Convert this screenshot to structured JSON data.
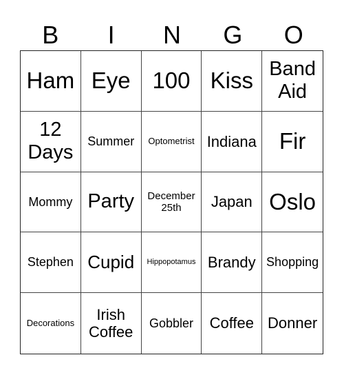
{
  "header": [
    "B",
    "I",
    "N",
    "G",
    "O"
  ],
  "cells": [
    [
      "Ham",
      "Eye",
      "100",
      "Kiss",
      "Band Aid"
    ],
    [
      "12 Days",
      "Summer",
      "Optometrist",
      "Indiana",
      "Fir"
    ],
    [
      "Mommy",
      "Party",
      "December 25th",
      "Japan",
      "Oslo"
    ],
    [
      "Stephen",
      "Cupid",
      "Hippopotamus",
      "Brandy",
      "Shopping"
    ],
    [
      "Decorations",
      "Irish Coffee",
      "Gobbler",
      "Coffee",
      "Donner"
    ]
  ]
}
